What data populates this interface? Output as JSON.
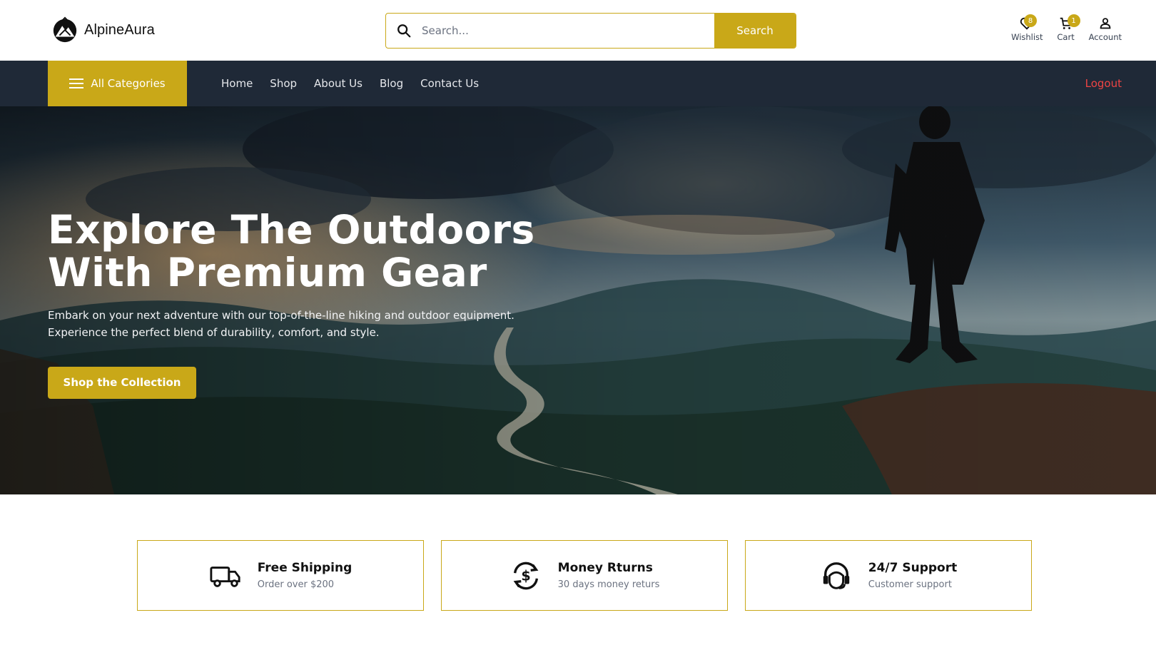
{
  "brand": {
    "name": "AlpineAura"
  },
  "search": {
    "placeholder": "Search...",
    "value": "",
    "button_label": "Search"
  },
  "header_icons": [
    {
      "icon": "heart-icon",
      "label": "Wishlist",
      "badge": "8"
    },
    {
      "icon": "cart-icon",
      "label": "Cart",
      "badge": "1"
    },
    {
      "icon": "user-icon",
      "label": "Account"
    }
  ],
  "nav": {
    "categories_label": "All Categories",
    "links": [
      "Home",
      "Shop",
      "About Us",
      "Blog",
      "Contact Us"
    ],
    "logout_label": "Logout"
  },
  "hero": {
    "title_line1": "Explore The Outdoors",
    "title_line2": "With Premium Gear",
    "subtitle_line1": "Embark on your next adventure with our top-of-the-line hiking and outdoor equipment.",
    "subtitle_line2": "Experience the perfect blend of durability, comfort, and style.",
    "cta_label": "Shop the Collection"
  },
  "features": [
    {
      "icon": "truck-icon",
      "title": "Free Shipping",
      "desc": "Order over $200"
    },
    {
      "icon": "money-return-icon",
      "title": "Money Rturns",
      "desc": "30 days money returs"
    },
    {
      "icon": "support-icon",
      "title": "24/7 Support",
      "desc": "Customer support"
    }
  ],
  "colors": {
    "accent": "#c9a818",
    "nav_bg": "#1f2937",
    "logout": "#ef4444"
  }
}
